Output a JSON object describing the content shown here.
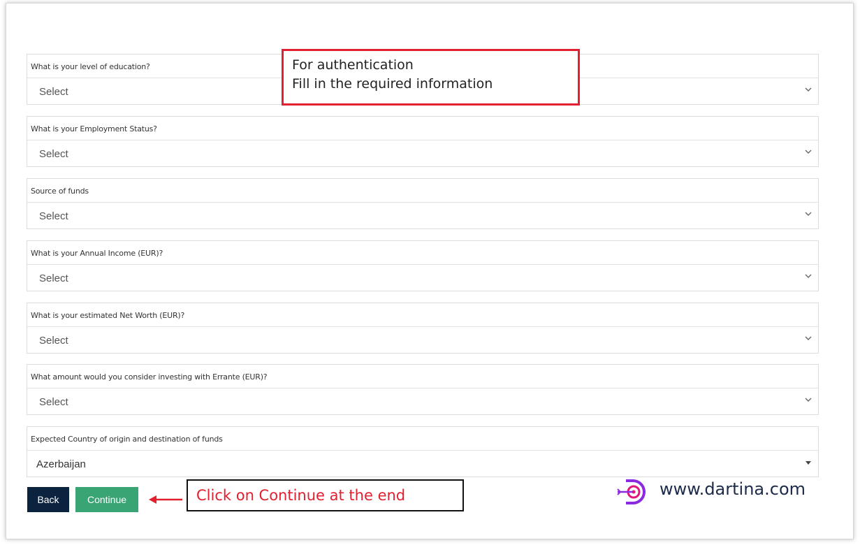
{
  "form": {
    "fields": [
      {
        "label": "What is your level of education?",
        "value": "Select"
      },
      {
        "label": "What is your Employment Status?",
        "value": "Select"
      },
      {
        "label": "Source of funds",
        "value": "Select"
      },
      {
        "label": "What is your Annual Income (EUR)?",
        "value": "Select"
      },
      {
        "label": "What is your estimated Net Worth (EUR)?",
        "value": "Select"
      },
      {
        "label": "What amount would you consider investing with Errante (EUR)?",
        "value": "Select"
      },
      {
        "label": "Expected Country of origin and destination of funds",
        "value": "Azerbaijan"
      }
    ],
    "back_label": "Back",
    "continue_label": "Continue"
  },
  "annotations": {
    "top_line1": "For authentication",
    "top_line2": "Fill in the required information",
    "bottom": "Click on Continue at the end"
  },
  "brand": {
    "url": "www.dartina.com"
  },
  "colors": {
    "back_button": "#0c2340",
    "continue_button": "#3aa574",
    "annotation_red": "#e2202f",
    "brand_purple": "#8a2be2",
    "brand_pink": "#e0187a"
  },
  "icons": {
    "select": "chevron-down-icon",
    "country_select": "caret-down-icon",
    "annotation_arrow": "arrow-left-icon",
    "brand_logo": "dartina-logo-icon"
  }
}
